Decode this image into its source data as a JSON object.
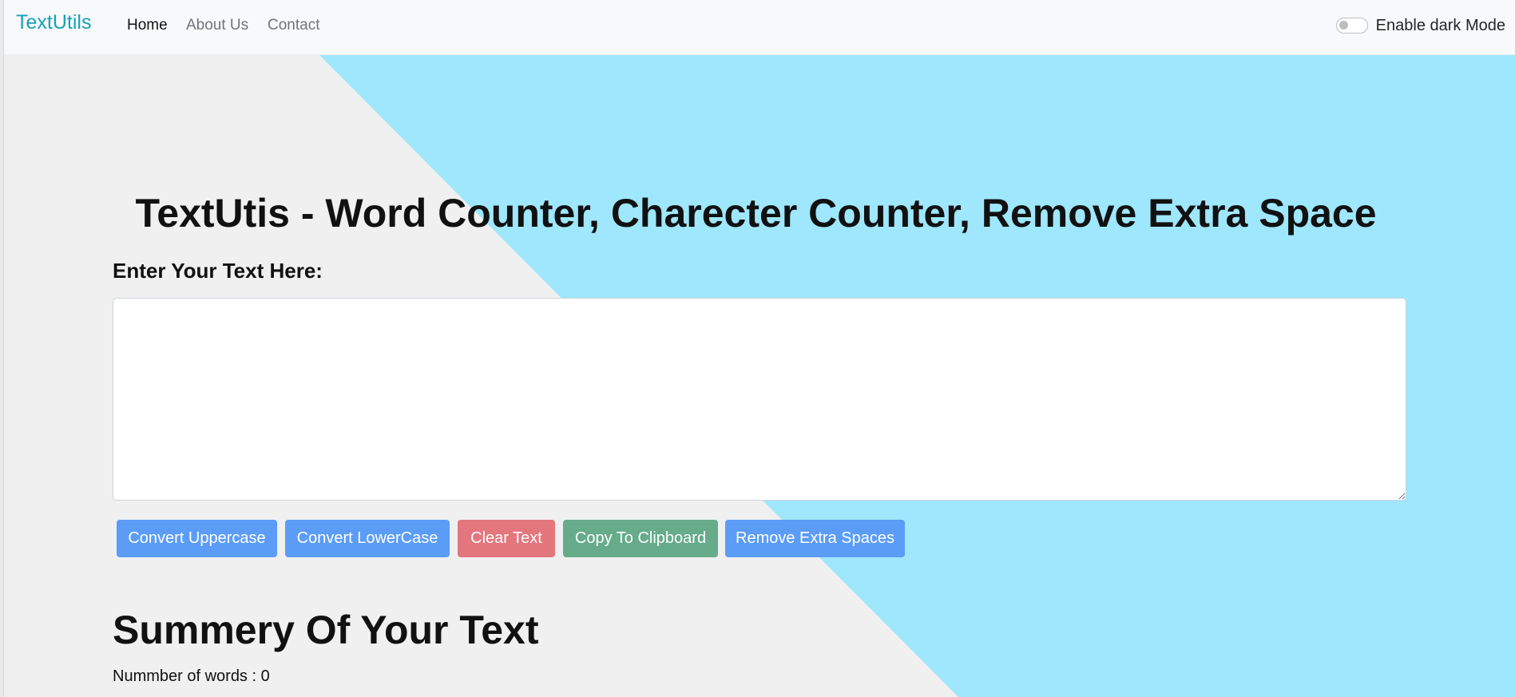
{
  "navbar": {
    "brand": "TextUtils",
    "links": [
      {
        "label": "Home",
        "active": true
      },
      {
        "label": "About Us",
        "active": false
      },
      {
        "label": "Contact",
        "active": false
      }
    ],
    "dark_mode_label": "Enable dark Mode",
    "dark_mode_on": false
  },
  "main": {
    "title": "TextUtis - Word Counter, Charecter Counter, Remove Extra Space",
    "input_label": "Enter Your Text Here:",
    "textarea_value": "",
    "buttons": [
      {
        "label": "Convert Uppercase",
        "color": "#5b9cf7"
      },
      {
        "label": "Convert LowerCase",
        "color": "#5b9cf7"
      },
      {
        "label": "Clear Text",
        "color": "#e4767d"
      },
      {
        "label": "Copy To Clipboard",
        "color": "#66ab8a"
      },
      {
        "label": "Remove Extra Spaces",
        "color": "#5b9cf7"
      }
    ],
    "summary_title": "Summery Of Your Text",
    "word_count_text": "Nummber of words : 0"
  },
  "colors": {
    "brand": "#17a2b8",
    "background_gray": "#f0f0f0",
    "background_cyan": "#9fe7fd",
    "navbar_bg": "#f8f9fa"
  }
}
